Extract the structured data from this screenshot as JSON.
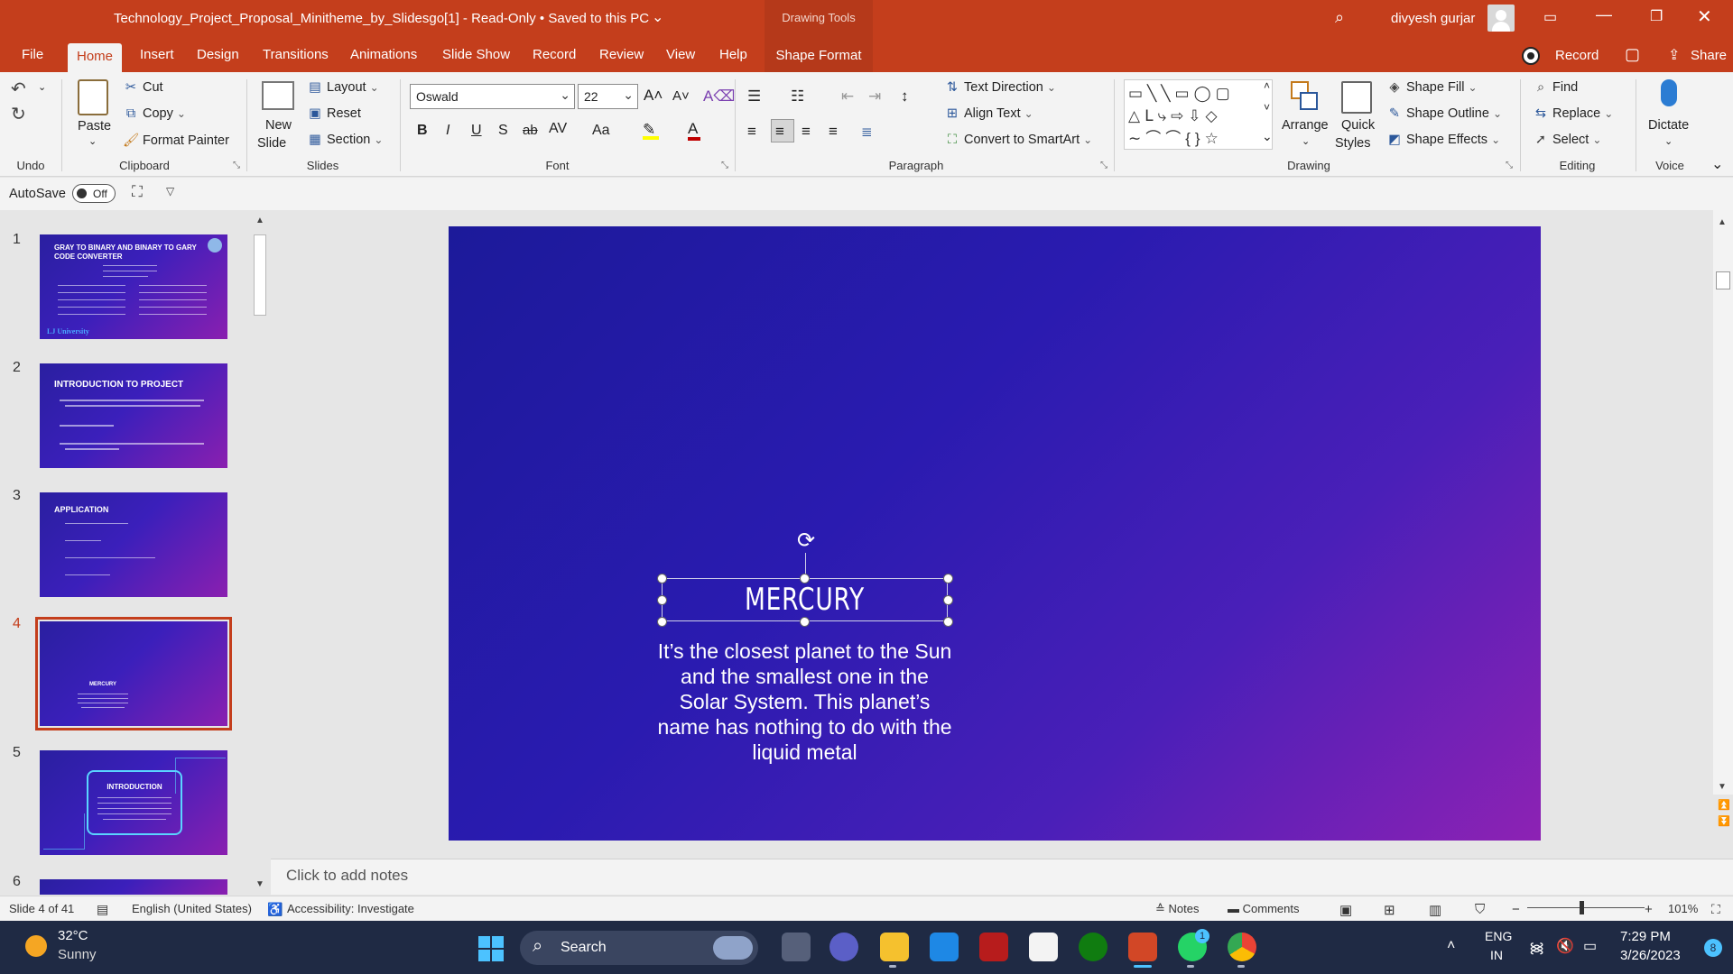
{
  "titlebar": {
    "document_title": "Technology_Project_Proposal_Minitheme_by_Slidesgo[1]  -  Read-Only  •  Saved to this PC",
    "context_tab_header": "Drawing Tools",
    "user_name": "divyesh gurjar"
  },
  "tabs": [
    "File",
    "Home",
    "Insert",
    "Design",
    "Transitions",
    "Animations",
    "Slide Show",
    "Record",
    "Review",
    "View",
    "Help",
    "Shape Format"
  ],
  "active_tab": "Home",
  "record_button": "Record",
  "share_button": "Share",
  "ribbon": {
    "undo_label": "Undo",
    "clipboard": {
      "paste": "Paste",
      "cut": "Cut",
      "copy": "Copy",
      "format_painter": "Format Painter",
      "label": "Clipboard"
    },
    "slides": {
      "new_slide_1": "New",
      "new_slide_2": "Slide",
      "layout": "Layout",
      "reset": "Reset",
      "section": "Section",
      "label": "Slides"
    },
    "font": {
      "family": "Oswald",
      "size": "22",
      "label": "Font",
      "bold": "B",
      "italic": "I",
      "underline": "U",
      "shadow": "S",
      "strike": "ab",
      "spacing": "AV",
      "case": "Aa"
    },
    "paragraph": {
      "text_direction": "Text Direction",
      "align_text": "Align Text",
      "convert_smartart": "Convert to SmartArt",
      "label": "Paragraph"
    },
    "drawing": {
      "arrange": "Arrange",
      "quick_styles_1": "Quick",
      "quick_styles_2": "Styles",
      "shape_fill": "Shape Fill",
      "shape_outline": "Shape Outline",
      "shape_effects": "Shape Effects",
      "label": "Drawing"
    },
    "editing": {
      "find": "Find",
      "replace": "Replace",
      "select": "Select",
      "label": "Editing"
    },
    "voice": {
      "dictate": "Dictate",
      "label": "Voice"
    }
  },
  "autosave": {
    "label": "AutoSave",
    "state": "Off"
  },
  "thumbnails": [
    {
      "number": "1",
      "title": "GRAY TO BINARY AND BINARY TO GARY CODE CONVERTER",
      "footer": "LJ University"
    },
    {
      "number": "2",
      "title": "INTRODUCTION TO PROJECT"
    },
    {
      "number": "3",
      "title": "APPLICATION"
    },
    {
      "number": "4",
      "title": "MERCURY"
    },
    {
      "number": "5",
      "title": "INTRODUCTION"
    },
    {
      "number": "6",
      "title": ""
    }
  ],
  "selected_slide": 4,
  "slide": {
    "title": "MERCURY",
    "body": "It’s the closest planet to the Sun and the smallest one in the Solar System. This planet’s name has nothing to do with the liquid metal"
  },
  "notes_placeholder": "Click to add notes",
  "statusbar": {
    "slide_counter": "Slide 4 of 41",
    "language": "English (United States)",
    "accessibility": "Accessibility: Investigate",
    "notes": "Notes",
    "comments": "Comments",
    "zoom": "101%"
  },
  "taskbar": {
    "temperature": "32°C",
    "weather": "Sunny",
    "search": "Search",
    "language_1": "ENG",
    "language_2": "IN",
    "time": "7:29 PM",
    "date": "3/26/2023",
    "notification_count": "8",
    "whatsapp_badge": "1"
  },
  "colors": {
    "accent": "#c43e1c",
    "slide_start": "#1c1a9a",
    "slide_end": "#8d22b4",
    "taskbar": "#1f2a44"
  }
}
